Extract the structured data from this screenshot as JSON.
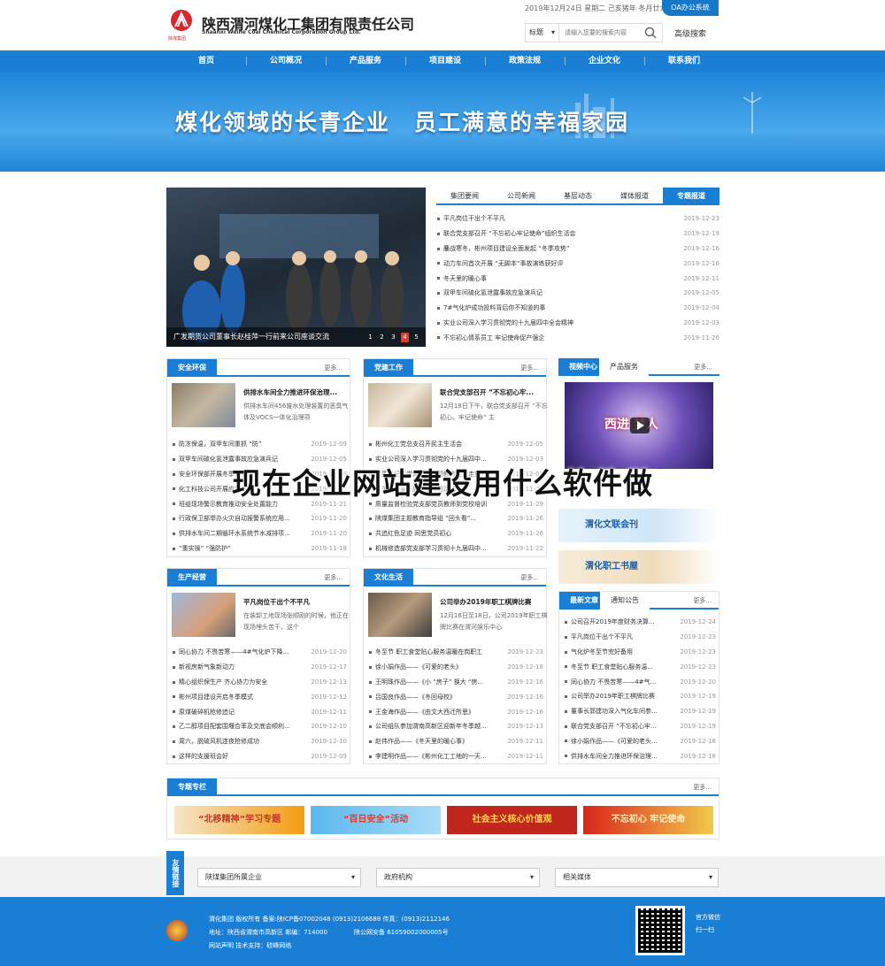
{
  "header": {
    "company_name": "陕西渭河煤化工集团有限责任公司",
    "company_name_en": "Shaanxi Weihe Coal Chemical Corporation Group Ltd.",
    "logo_text": "陕煤集团",
    "date_line": "2019年12月24日 星期二 己亥猪年 冬月廿九",
    "oa_label": "OA办公系统",
    "search_select": "标题",
    "search_placeholder": "请输入您要的搜索内容",
    "advanced_search": "高级搜索"
  },
  "nav": [
    "首页",
    "公司概况",
    "产品服务",
    "项目建设",
    "政策法规",
    "企业文化",
    "联系我们"
  ],
  "banner": {
    "slogan": "煤化领域的长青企业　员工满意的幸福家园"
  },
  "slideshow": {
    "caption": "广发期货公司董事长赵桂萍一行前来公司座谈交流",
    "pages": [
      "1",
      "2",
      "3",
      "4",
      "5"
    ],
    "active": 4
  },
  "news_tabs": [
    "集团要闻",
    "公司新闻",
    "基层动态",
    "媒体报道",
    "专题报道"
  ],
  "news_active_tab": 4,
  "news": [
    {
      "t": "平凡岗位干出个不平凡",
      "d": "2019-12-23"
    },
    {
      "t": "联合党支部召开 “不忘初心牢记使命”组织生活会",
      "d": "2019-12-19"
    },
    {
      "t": "鏖战寒冬，彬州项目建设全面发起 “冬季攻势”",
      "d": "2019-12-16"
    },
    {
      "t": "动力车间首次开展 “无脚本”事故演练获好评",
      "d": "2019-12-16"
    },
    {
      "t": "冬天里的暖心事",
      "d": "2019-12-11"
    },
    {
      "t": "双甲车间硫化氢泄露事故应急演兵记",
      "d": "2019-12-05"
    },
    {
      "t": "7#气化炉成功投料背后你不知道的事",
      "d": "2019-12-04"
    },
    {
      "t": "实业公司深入学习贯彻党的十九届四中全会精神",
      "d": "2019-12-03"
    },
    {
      "t": "不忘初心情系员工 牢记使命促产强企",
      "d": "2019-11-26"
    }
  ],
  "safety": {
    "title": "安全环保",
    "more": "更多...",
    "feature_title": "供排水车间全力推进环保治理...",
    "feature_desc": "供排水车间456废水处理装置的恶臭气体及VOCS一体化治理项",
    "items": [
      {
        "t": "防冻保温，双甲车间重抓 “防”",
        "d": "2019-12-09"
      },
      {
        "t": "双甲车间硫化氢泄露事故应急演兵记",
        "d": "2019-12-05"
      },
      {
        "t": "安全环保部开展冬季安全检查",
        "d": "2019-11-28"
      },
      {
        "t": "化工科技公司开展应急演练",
        "d": "2019-11-25"
      },
      {
        "t": "班组现场警示教育推动安全处置能力",
        "d": "2019-11-21"
      },
      {
        "t": "行政保卫部举办火灾自动报警系统应用...",
        "d": "2019-11-20"
      },
      {
        "t": "供排水车间二期循环水系统节水减排项...",
        "d": "2019-11-20"
      },
      {
        "t": "“重实操” “强防护”",
        "d": "2019-11-18"
      }
    ]
  },
  "party": {
    "title": "党建工作",
    "more": "更多...",
    "feature_title": "联合党支部召开 “不忘初心牢...",
    "feature_desc": "12月18日下午，联合党支部召开 “不忘初心、牢记使命” 主",
    "items": [
      {
        "t": "彬州化工党总支召开民主生活会",
        "d": "2019-12-05"
      },
      {
        "t": "实业公司深入学习贯彻党的十九届四中...",
        "d": "2019-12-03"
      },
      {
        "t": "党委书记讲党课推动主题教育走深走实",
        "d": "2019-12-02"
      },
      {
        "t": "机关党支部开展主题党日活动",
        "d": "2019-11-29"
      },
      {
        "t": "质量监督检验党支部党员教师到党校培训",
        "d": "2019-11-29"
      },
      {
        "t": "陕煤集团主题教育指导组 “回头看”...",
        "d": "2019-11-26"
      },
      {
        "t": "共追红色足迹 同思党员初心",
        "d": "2019-11-26"
      },
      {
        "t": "机械修造部党支部学习贯彻十九届四中...",
        "d": "2019-11-22"
      }
    ]
  },
  "video": {
    "tab_active": "视频中心",
    "tab_other": "产品服务",
    "more": "更多...",
    "title": "西进 梦人"
  },
  "promos": [
    "渭化文联会刊",
    "渭化职工书屋"
  ],
  "production": {
    "title": "生产经营",
    "more": "更多...",
    "feature_title": "平凡岗位干出个不平凡",
    "feature_desc": "在装卸工地现场张顺刚的时候，他正在现场埋头苦干，这个",
    "items": [
      {
        "t": "同心协力 不畏苦寒——4#气化炉下降...",
        "d": "2019-12-20"
      },
      {
        "t": "新视房新气象新动力",
        "d": "2019-12-17"
      },
      {
        "t": "精心组织保生产 齐心协力为安全",
        "d": "2019-12-13"
      },
      {
        "t": "彬州项目建设开启冬季模式",
        "d": "2019-12-12"
      },
      {
        "t": "原煤破碎机抢修追记",
        "d": "2019-12-11"
      },
      {
        "t": "乙二醇项目配套围堰合率及交底会顺利...",
        "d": "2019-12-10"
      },
      {
        "t": "周六，脱硫风机连夜抢修成功",
        "d": "2019-12-10"
      },
      {
        "t": "这样的支援班会好",
        "d": "2019-12-09"
      }
    ]
  },
  "culture": {
    "title": "文化生活",
    "more": "更多...",
    "feature_title": "公司举办2019年职工棋牌比赛",
    "feature_desc": "12月16日至18日，公司2019年职工棋牌比赛在渭河娱乐中心",
    "items": [
      {
        "t": "冬至节 职工食堂贴心服务温暖在岗职工",
        "d": "2019-12-23"
      },
      {
        "t": "徐小娟作品——《可爱的老头》",
        "d": "2019-12-18"
      },
      {
        "t": "王明珠作品——《小 “房子” 换大 “房...",
        "d": "2019-12-16"
      },
      {
        "t": "吕国良作品——《冬回母校》",
        "d": "2019-12-16"
      },
      {
        "t": "王金海作品——《由文大西迁所思》",
        "d": "2019-12-16"
      },
      {
        "t": "公司组队参加渭南高新区迎新年冬季越...",
        "d": "2019-12-13"
      },
      {
        "t": "赵伟作品——《冬天里的暖心事》",
        "d": "2019-12-11"
      },
      {
        "t": "李建明作品——《彬州化工工地的一天...",
        "d": "2019-12-11"
      }
    ]
  },
  "latest": {
    "tab_active": "最新文章",
    "tab_other": "通知公告",
    "more": "更多...",
    "items": [
      {
        "t": "公司召开2019年度财务决算...",
        "d": "2019-12-24"
      },
      {
        "t": "平凡岗位干出个不平凡",
        "d": "2019-12-23"
      },
      {
        "t": "气化炉冬至节完好备用",
        "d": "2019-12-23"
      },
      {
        "t": "冬至节 职工食堂贴心服务温...",
        "d": "2019-12-23"
      },
      {
        "t": "同心协力 不畏苦寒——4#气...",
        "d": "2019-12-20"
      },
      {
        "t": "公司举办2019年职工棋牌比赛",
        "d": "2019-12-19"
      },
      {
        "t": "董事长郭建功深入气化车间参...",
        "d": "2019-12-19"
      },
      {
        "t": "联合党支部召开 “不忘初心牢...",
        "d": "2019-12-19"
      },
      {
        "t": "徐小娟作品——《可爱的老头...",
        "d": "2019-12-18"
      },
      {
        "t": "供排水车间全力推进环保治理...",
        "d": "2019-12-18"
      }
    ]
  },
  "special": {
    "title": "专题专栏",
    "more": "更多...",
    "banners": [
      "“北移精神”学习专题",
      "“百日安全”活动",
      "社会主义核心价值观",
      "不忘初心 牢记使命"
    ]
  },
  "links": {
    "label": "友情链接",
    "dropdowns": [
      "陕煤集团所属企业",
      "政府机构",
      "相关媒体"
    ]
  },
  "footer": {
    "line1": "渭化集团 版权所有  备案:陕ICP备07002048    (0913)2106688  传真：(0913)2112146",
    "line2": "地址：陕西省渭南市高新区  邮编：714000",
    "police": "陕公网安备 61059002000005号",
    "line3": "网站声明        技术支持：硅峰网络",
    "wechat": "官方微信",
    "scan": "扫一扫"
  },
  "watermark": "现在企业网站建设用什么软件做"
}
